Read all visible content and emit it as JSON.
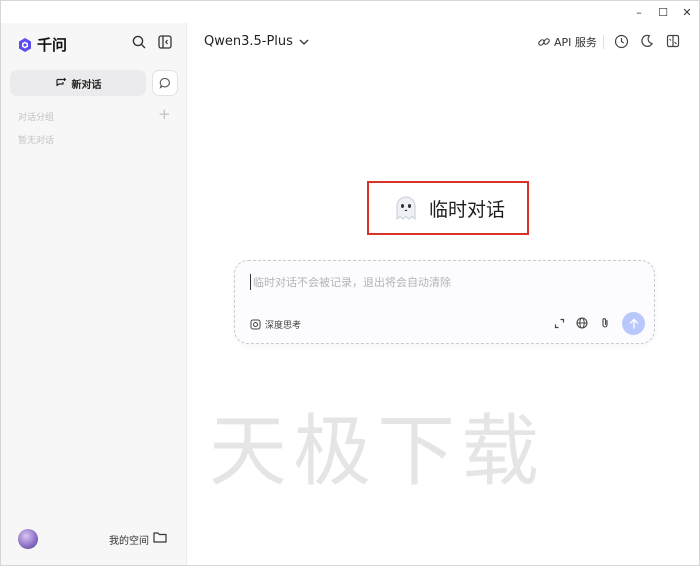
{
  "window_controls": {
    "minimize": "–",
    "maximize": "☐",
    "close": "✕"
  },
  "sidebar": {
    "brand": "千问",
    "new_chat_label": "新对话",
    "group_label": "对话分组",
    "group_add": "+",
    "empty_label": "暂无对话",
    "space_label": "我的空间"
  },
  "header": {
    "model_name": "Qwen3.5-Plus",
    "api_label": "API 服务"
  },
  "main": {
    "temp_title": "临时对话",
    "input_placeholder": "临时对话不会被记录，退出将会自动清除",
    "deep_think_label": "深度思考"
  },
  "watermark": "天极下载",
  "colors": {
    "brand_blue": "#5b4cf0",
    "highlight_border": "#d9322d",
    "send_button": "#b9c7fb",
    "sidebar_bg": "#f7f7f8"
  }
}
